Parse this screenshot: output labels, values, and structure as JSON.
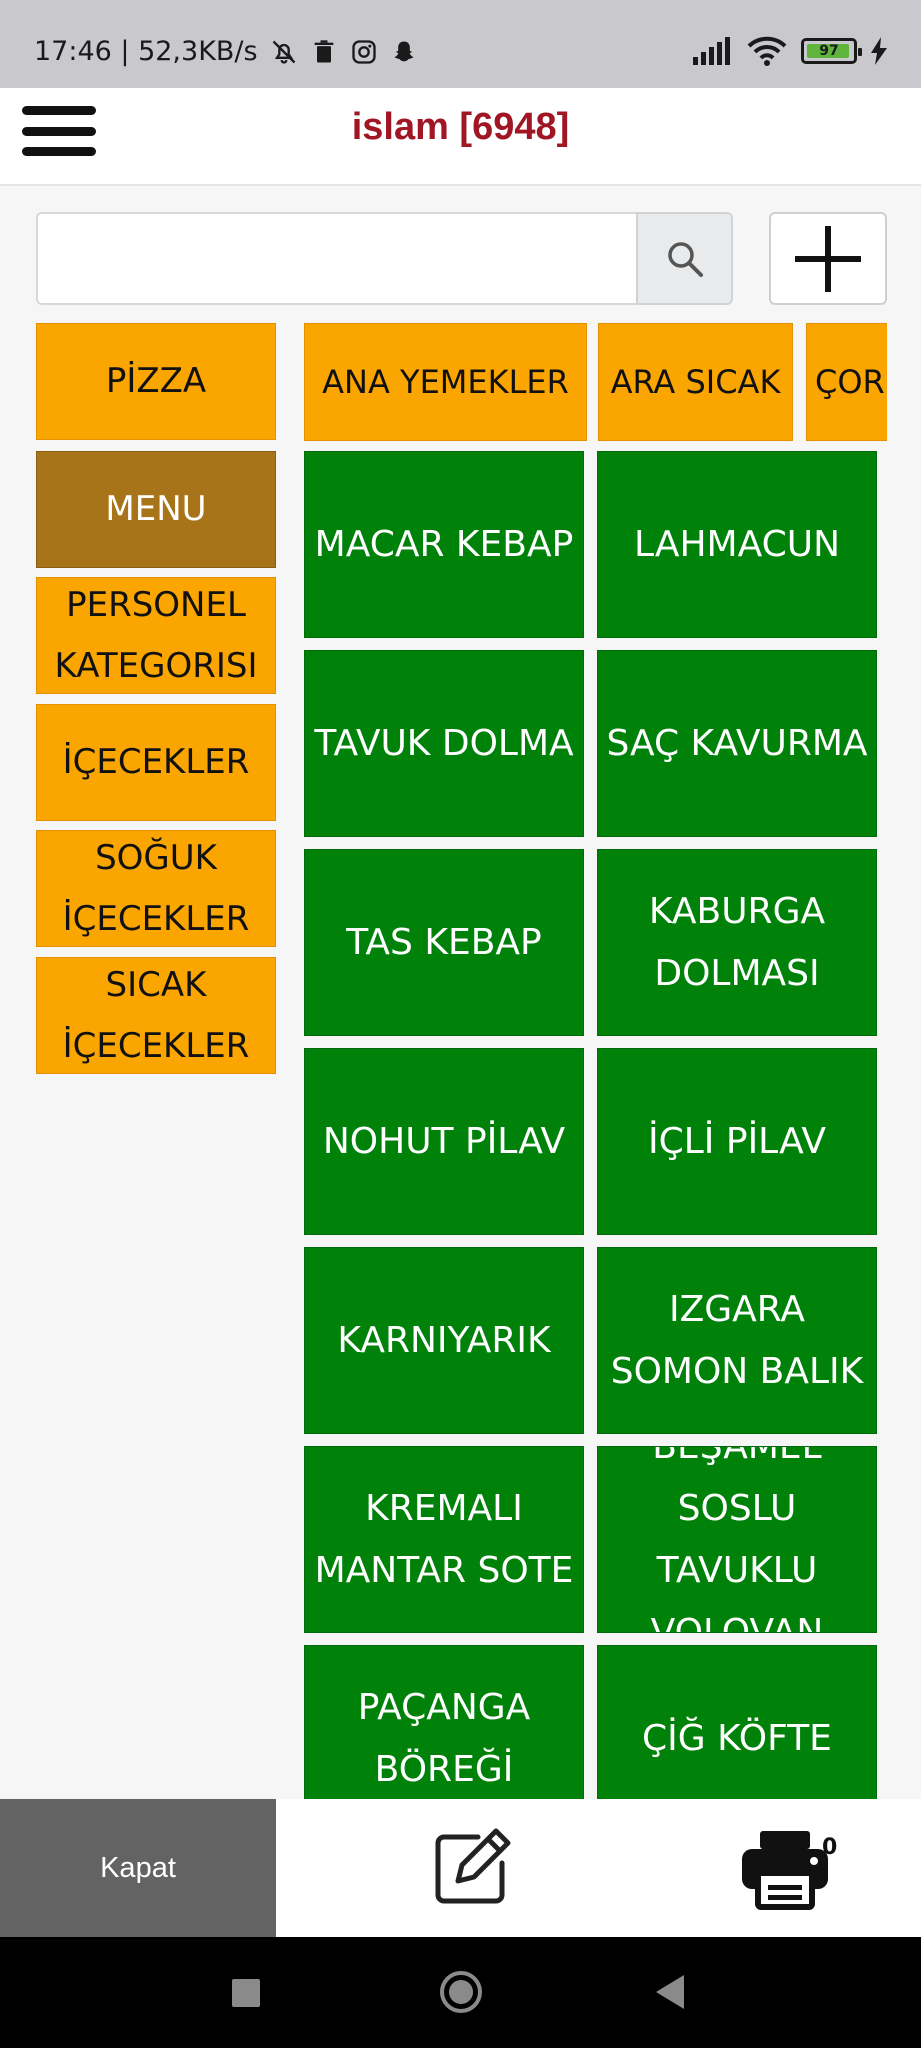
{
  "status_bar": {
    "time_speed": "17:46 | 52,3KB/s",
    "battery_level": "97",
    "icons": [
      "bell-off-icon",
      "trash-icon",
      "instagram-icon",
      "snapchat-icon",
      "signal-icon",
      "wifi-icon",
      "battery-icon",
      "charging-icon"
    ]
  },
  "header": {
    "title": "islam [6948]",
    "menu_icon": "hamburger-icon"
  },
  "search": {
    "placeholder": "",
    "value": "",
    "search_icon": "search-icon",
    "add_icon": "plus-icon"
  },
  "categories": [
    {
      "label": "PİZZA",
      "active": false
    },
    {
      "label": "MENU",
      "active": true
    },
    {
      "label": "PERSONEL KATEGORISI",
      "active": false
    },
    {
      "label": "İÇECEKLER",
      "active": false
    },
    {
      "label": "SOĞUK İÇECEKLER",
      "active": false
    },
    {
      "label": "SICAK İÇECEKLER",
      "active": false
    }
  ],
  "subcategories": [
    "ANA YEMEKLER",
    "ARA SICAK",
    "ÇOR"
  ],
  "products": [
    "MACAR KEBAP",
    "LAHMACUN",
    "TAVUK DOLMA",
    "SAÇ KAVURMA",
    "TAS KEBAP",
    "KABURGA DOLMASI",
    "NOHUT PİLAV",
    "İÇLİ PİLAV",
    "KARNIYARIK",
    "IZGARA SOMON BALIK",
    "KREMALI MANTAR SOTE",
    "BEŞAMEL SOSLU TAVUKLU VOLOVAN",
    "PAÇANGA BÖREĞİ",
    "ÇİĞ KÖFTE"
  ],
  "footer": {
    "close_label": "Kapat",
    "edit_icon": "edit-icon",
    "print_icon": "printer-icon",
    "print_count": "0"
  },
  "colors": {
    "category": "#fba500",
    "category_active": "#a8741a",
    "product": "#00820a",
    "title": "#a01624",
    "close_button": "#636363"
  }
}
